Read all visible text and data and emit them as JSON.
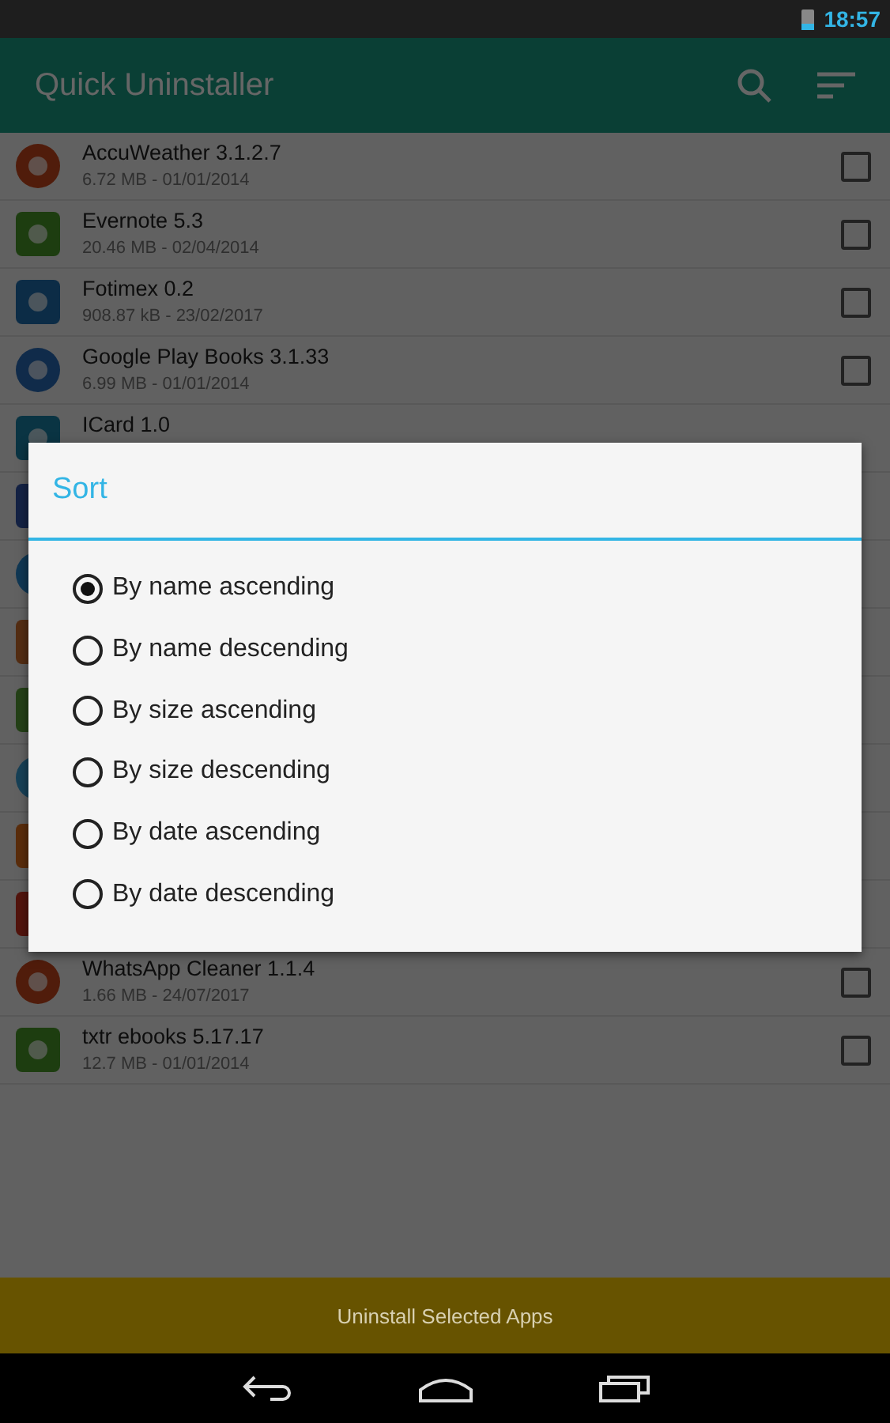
{
  "status_bar": {
    "time": "18:57"
  },
  "app_bar": {
    "title": "Quick Uninstaller"
  },
  "apps": [
    {
      "kind": "app",
      "name": "AccuWeather 3.1.2.7",
      "detail": "6.72 MB - 01/01/2014",
      "checked": false
    },
    {
      "kind": "app",
      "name": "Evernote 5.3",
      "detail": "20.46 MB - 02/04/2014",
      "checked": false
    },
    {
      "kind": "app",
      "name": "Fotimex 0.2",
      "detail": "908.87 kB - 23/02/2017",
      "checked": false
    },
    {
      "kind": "app",
      "name": "Google Play Books 3.1.33",
      "detail": "6.99 MB - 01/01/2014",
      "checked": false
    },
    {
      "kind": "covered",
      "name": "ICard 1.0"
    },
    {
      "kind": "covered"
    },
    {
      "kind": "covered"
    },
    {
      "kind": "covered"
    },
    {
      "kind": "covered"
    },
    {
      "kind": "covered"
    },
    {
      "kind": "covered"
    },
    {
      "kind": "covered"
    },
    {
      "kind": "app",
      "name": "WhatsApp Cleaner 1.1.4",
      "detail": "1.66 MB - 24/07/2017",
      "checked": false
    },
    {
      "kind": "app",
      "name": "txtr ebooks 5.17.17",
      "detail": "12.7 MB - 01/01/2014",
      "checked": false
    }
  ],
  "action_button": "Uninstall Selected Apps",
  "dialog": {
    "title": "Sort",
    "options": [
      {
        "label": "By name ascending",
        "selected": true
      },
      {
        "label": "By name descending",
        "selected": false
      },
      {
        "label": "By size ascending",
        "selected": false
      },
      {
        "label": "By size descending",
        "selected": false
      },
      {
        "label": "By date ascending",
        "selected": false
      },
      {
        "label": "By date descending",
        "selected": false
      }
    ]
  }
}
